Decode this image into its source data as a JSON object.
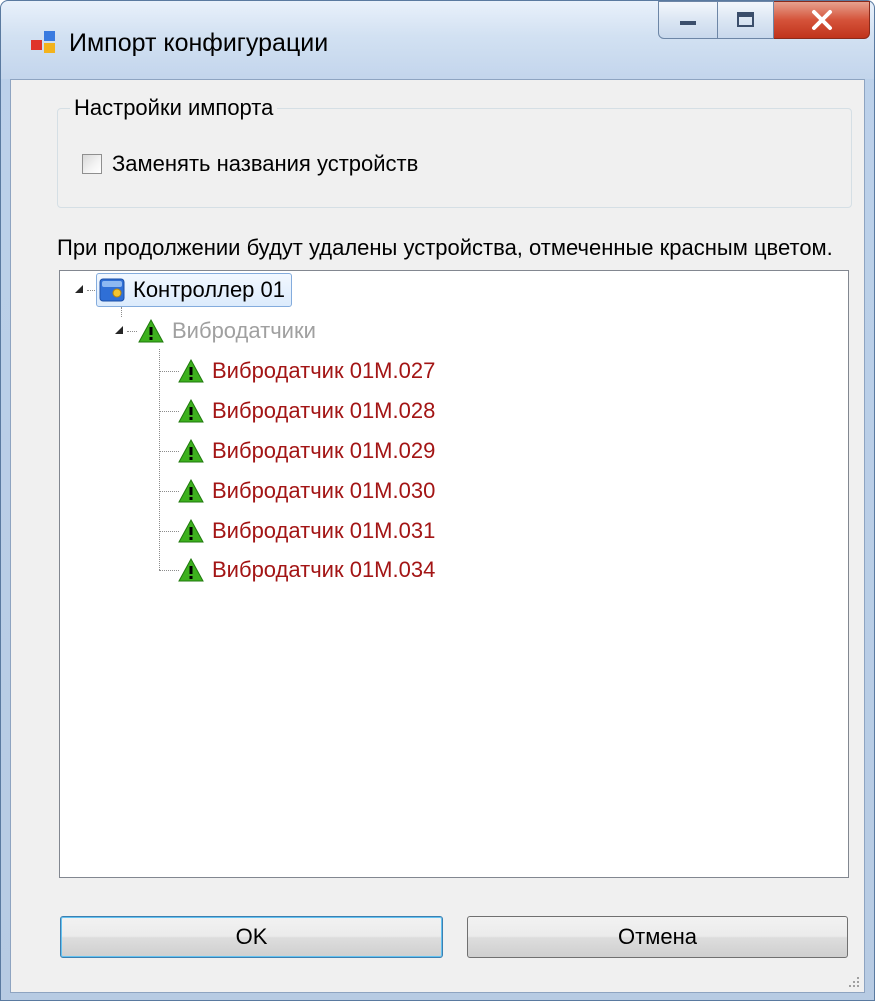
{
  "window": {
    "title": "Импорт конфигурации",
    "controls": {
      "minimize": "minimize-icon",
      "maximize": "maximize-icon",
      "close": "close-icon"
    }
  },
  "settings": {
    "group_label": "Настройки импорта",
    "replace_names": {
      "label": "Заменять названия устройств",
      "checked": false
    }
  },
  "info_text": "При продолжении будут удалены устройства, отмеченные красным цветом.",
  "tree": {
    "root": {
      "label": "Контроллер 01",
      "icon": "controller-icon",
      "expanded": true,
      "selected": true
    },
    "group": {
      "label": "Вибродатчики",
      "icon": "warning-icon",
      "expanded": true
    },
    "items": [
      {
        "label": "Вибродатчик 01М.027",
        "icon": "warning-icon"
      },
      {
        "label": "Вибродатчик 01М.028",
        "icon": "warning-icon"
      },
      {
        "label": "Вибродатчик 01М.029",
        "icon": "warning-icon"
      },
      {
        "label": "Вибродатчик 01М.030",
        "icon": "warning-icon"
      },
      {
        "label": "Вибродатчик 01М.031",
        "icon": "warning-icon"
      },
      {
        "label": "Вибродатчик 01М.034",
        "icon": "warning-icon"
      }
    ]
  },
  "buttons": {
    "ok": "OK",
    "cancel": "Отмена"
  },
  "colors": {
    "delete_item": "#a31515",
    "group_disabled": "#a0a0a0",
    "warning_fill": "#3db01e",
    "controller_blue": "#2f6fd6"
  }
}
